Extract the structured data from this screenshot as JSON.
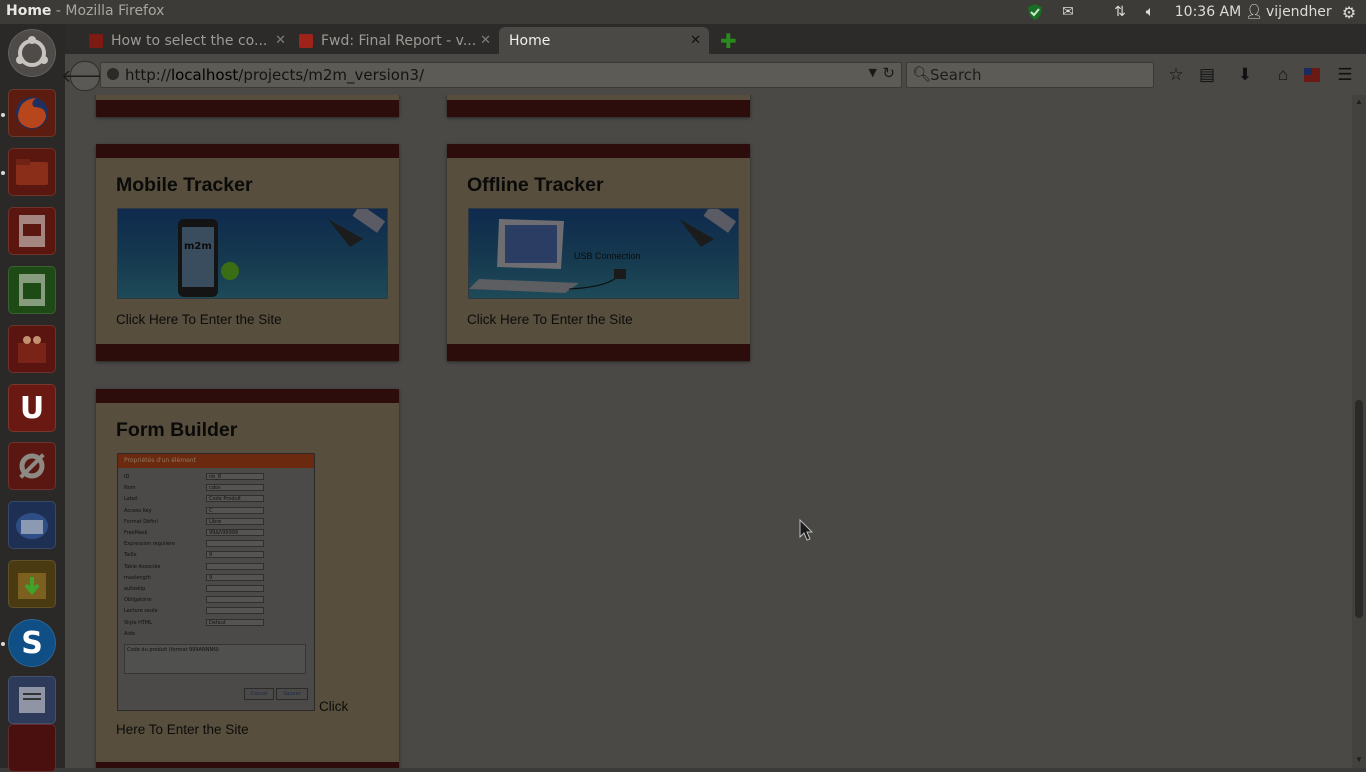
{
  "window": {
    "title_app": "Home",
    "title_sep": " - Mozilla Firefox"
  },
  "topbar": {
    "clock": "10:36 AM",
    "user": "vijendher"
  },
  "tabs": [
    {
      "label": "How to select the co...",
      "active": false
    },
    {
      "label": "Fwd: Final Report - v...",
      "active": false
    },
    {
      "label": "Home",
      "active": true
    }
  ],
  "nav": {
    "url_prefix": "http://",
    "url_host": "localhost",
    "url_path": "/projects/m2m_version3/",
    "search_placeholder": "Search"
  },
  "cards": [
    {
      "title": "Mobile Tracker",
      "link": "Click Here To Enter the Site",
      "image_text": "m2m solutions"
    },
    {
      "title": "Offline Tracker",
      "link": "Click Here To Enter the Site",
      "image_text": "USB Connection"
    },
    {
      "title": "Form Builder",
      "link_first": "Click",
      "link_rest": "Here To Enter the Site"
    }
  ],
  "form_image": {
    "header": "Propriétés d'un élément",
    "rows": [
      "ID",
      "Nom",
      "Label",
      "Access Key",
      "Format Défini",
      "FreeMask",
      "Expression regulière",
      "Taille",
      "Table Associée",
      "maxlength",
      "autoskip",
      "Obligatoire",
      "Lecture seule",
      "Style HTML",
      "Aide"
    ],
    "values": [
      "nb_8",
      "cdos",
      "Code Produit",
      "C",
      "Libre",
      "99ΔΛ99999",
      "",
      "9",
      "",
      "9",
      "",
      "",
      "",
      "Defaut",
      ""
    ],
    "help_text": "Code du produit (format 999ANNNN)",
    "cancel": "Cancel",
    "save": "Sauver"
  },
  "colors": {
    "card_body": "#574e3d",
    "card_bar": "#2d0d0b",
    "page_bg": "#4a4946"
  }
}
